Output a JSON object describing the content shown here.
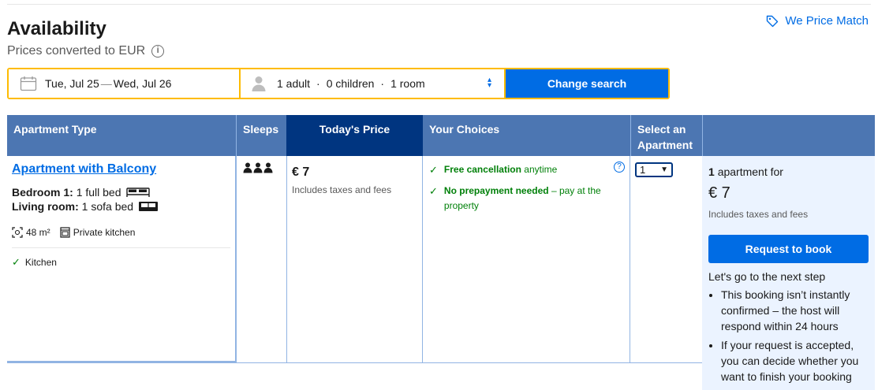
{
  "header": {
    "title": "Availability",
    "subtitle": "Prices converted to EUR",
    "info_icon": "i",
    "price_match": "We Price Match"
  },
  "search": {
    "check_in": "Tue, Jul 25",
    "separator": "—",
    "check_out": "Wed, Jul 26",
    "adults": "1 adult",
    "children": "0 children",
    "rooms": "1 room",
    "dot": "·",
    "button": "Change search"
  },
  "table": {
    "headers": {
      "type": "Apartment Type",
      "sleeps": "Sleeps",
      "price": "Today's Price",
      "choices": "Your Choices",
      "select": "Select an Apartment"
    },
    "row": {
      "name": "Apartment with Balcony",
      "bed1_label": "Bedroom 1:",
      "bed1_value": "1 full bed",
      "bed2_label": "Living room:",
      "bed2_value": "1 sofa bed",
      "area": "48 m²",
      "kitchen_facility": "Private kitchen",
      "amenity": "Kitchen",
      "price": "€ 7",
      "tax_note": "Includes taxes and fees",
      "choice1_bold": "Free cancellation",
      "choice1_rest": "anytime",
      "choice2_bold": "No prepayment needed",
      "choice2_rest": "– pay at the property",
      "select_value": "1",
      "help_icon": "?"
    }
  },
  "sidebar": {
    "count_bold": "1",
    "count_rest": "apartment for",
    "price": "€ 7",
    "tax_note": "Includes taxes and fees",
    "button": "Request to book",
    "next_step": "Let's go to the next step",
    "bullets": [
      "This booking isn’t instantly confirmed – the host will respond within 24 hours",
      "If your request is accepted, you can decide whether you want to finish your booking"
    ]
  },
  "colors": {
    "brand_blue": "#006ce4",
    "header_blue": "#4c76b2",
    "dark_blue": "#003580",
    "search_border": "#febb02",
    "green": "#008009"
  }
}
